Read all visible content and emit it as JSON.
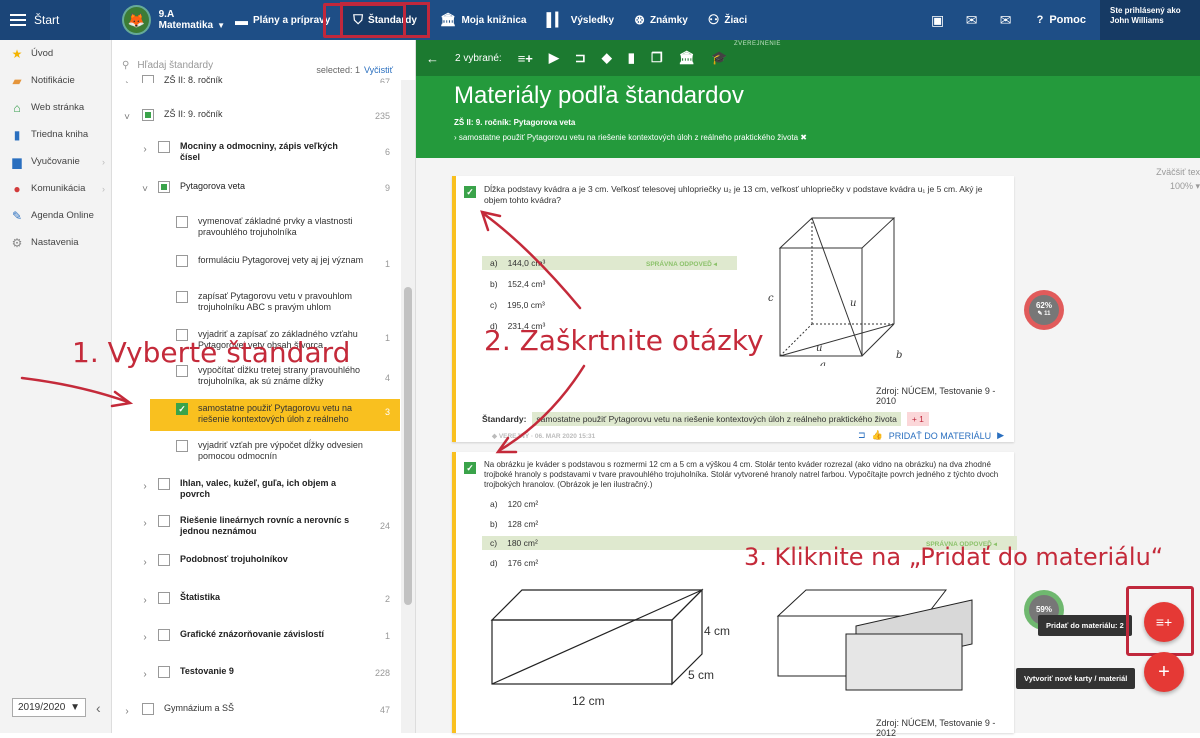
{
  "topbar": {
    "home": "Štart",
    "class_name": "9.A",
    "subject": "Matematika",
    "items": [
      "Plány a prípravy",
      "Štandardy",
      "Moja knižnica",
      "Výsledky",
      "Známky",
      "Žiaci"
    ],
    "help": "Pomoc",
    "user_caption": "Ste prihlásený ako",
    "user_name": "John Williams"
  },
  "sidebar": {
    "items": [
      "Úvod",
      "Notifikácie",
      "Web stránka",
      "Triedna kniha",
      "Vyučovanie",
      "Komunikácia",
      "Agenda Online",
      "Nastavenia"
    ],
    "year": "2019/2020"
  },
  "standards": {
    "search_placeholder": "Hľadaj štandardy",
    "selected_text": "selected: 1",
    "clear_label": "Vyčistiť",
    "rows": [
      {
        "label": "ZŠ II: 8. ročník",
        "count": "67"
      },
      {
        "label": "ZŠ II: 9. ročník",
        "count": "235"
      },
      {
        "label": "Mocniny a odmocniny, zápis veľkých čísel",
        "count": "6"
      },
      {
        "label": "Pytagorova veta",
        "count": "9"
      },
      {
        "label": "vymenovať základné prvky a vlastnosti pravouhlého trojuholníka",
        "count": ""
      },
      {
        "label": "formuláciu Pytagorovej vety aj jej význam",
        "count": "1"
      },
      {
        "label": "zapísať Pytagorovu vetu v pravouhlom trojuholníku ABC s pravým uhlom",
        "count": ""
      },
      {
        "label": "vyjadriť a zapísať zo základného vzťahu Pytagorovej vety obsah štvorca",
        "count": "1"
      },
      {
        "label": "vypočítať dĺžku tretej strany pravouhlého trojuholníka, ak sú známe dĺžky",
        "count": "4"
      },
      {
        "label": "samostatne použiť Pytagorovu vetu na riešenie kontextových úloh z reálneho",
        "count": "3"
      },
      {
        "label": "vyjadriť vzťah pre výpočet dĺžky odvesien pomocou odmocnín",
        "count": ""
      },
      {
        "label": "Ihlan, valec, kužeľ, guľa, ich objem a povrch",
        "count": ""
      },
      {
        "label": "Riešenie lineárnych rovníc a nerovníc s jednou neznámou",
        "count": "24"
      },
      {
        "label": "Podobnosť trojuholníkov",
        "count": ""
      },
      {
        "label": "Štatistika",
        "count": "2"
      },
      {
        "label": "Grafické znázorňovanie závislostí",
        "count": "1"
      },
      {
        "label": "Testovanie 9",
        "count": "228"
      },
      {
        "label": "Gymnázium a SŠ",
        "count": "47"
      }
    ]
  },
  "main": {
    "selected_count": "2 vybrané:",
    "published_label": "ZVEREJNENIE",
    "title": "Materiály podľa štandardov",
    "breadcrumb": "ZŠ II: 9. ročník: Pytagorova veta",
    "active_standard": "samostatne použiť Pytagorovu vetu na riešenie kontextových úloh z reálneho praktického života ✖",
    "zoom_label": "Zväčšiť tex",
    "zoom_value": "100%",
    "q1": {
      "text": "Dĺžka podstavy kvádra a je 3 cm. Veľkosť telesovej uhlopriečky u₂ je 13 cm, veľkosť uhlopriečky v podstave kvádra u₁ je 5 cm. Aký je objem tohto kvádra?",
      "answers": [
        {
          "letter": "a)",
          "value": "144,0 cm³"
        },
        {
          "letter": "b)",
          "value": "152,4 cm³"
        },
        {
          "letter": "c)",
          "value": "195,0 cm³"
        },
        {
          "letter": "d)",
          "value": "231,4 cm³"
        }
      ],
      "correct_label": "SPRÁVNA ODPOVEĎ",
      "source": "Zdroj: NÚCEM, Testovanie 9 - 2010",
      "standard_label": "Štandardy:",
      "standard_text": "samostatne použiť Pytagorovu vetu na riešenie kontextových úloh z reálneho praktického života",
      "plus": "+ 1",
      "meta": "VEREJNÝ · 06. MAR 2020 15:31",
      "add_label": "PRIDAŤ DO MATERIÁLU",
      "gauge": "62%",
      "gauge_sub": "11"
    },
    "q2": {
      "text": "Na obrázku je kváder s podstavou s rozmermi 12 cm a 5 cm a výškou 4 cm. Stolár tento kváder rozrezal (ako vidno na obrázku) na dva zhodné trojboké hranoly s podstavami v tvare pravouhlého trojuholníka. Stolár vytvorené hranoly natrel farbou. Vypočítajte povrch jedného z týchto dvoch trojbokých hranolov. (Obrázok je len ilustračný.)",
      "answers": [
        {
          "letter": "a)",
          "value": "120 cm²"
        },
        {
          "letter": "b)",
          "value": "128 cm²"
        },
        {
          "letter": "c)",
          "value": "180 cm²"
        },
        {
          "letter": "d)",
          "value": "176 cm²"
        }
      ],
      "correct_label": "SPRÁVNA ODPOVEĎ",
      "source": "Zdroj: NÚCEM, Testovanie 9 - 2012",
      "gauge": "59%",
      "dims": [
        "4 cm",
        "5 cm",
        "12 cm"
      ]
    },
    "tooltip_add": "Pridať do materiálu: 2",
    "tooltip_new": "Vytvoriť nové karty / materiál"
  },
  "annotations": {
    "step1": "1. Vyberte štandard",
    "step2": "2. Zaškrtnite otázky",
    "step3": "3. Kliknite na „Pridať do materiálu“"
  },
  "colors": {
    "topbar": "#1e4e86",
    "green_bar": "#1c7a30",
    "green_header": "#249a3c",
    "highlight": "#f9c01f",
    "annotation": "#c42a3a",
    "fab": "#e53935"
  }
}
